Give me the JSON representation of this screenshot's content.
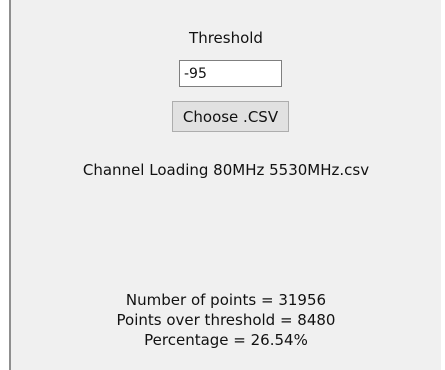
{
  "threshold": {
    "label": "Threshold",
    "value": "-95"
  },
  "choose_button": {
    "label": "Choose .CSV"
  },
  "file": {
    "name": "Channel Loading 80MHz 5530MHz.csv"
  },
  "results": {
    "points_line": "Number of points = 31956",
    "over_threshold_line": "Points over threshold = 8480",
    "percentage_line": "Percentage = 26.54%"
  },
  "colors": {
    "panel_background": "#f0f0f0",
    "button_background": "#e1e1e1",
    "text": "#111111"
  }
}
